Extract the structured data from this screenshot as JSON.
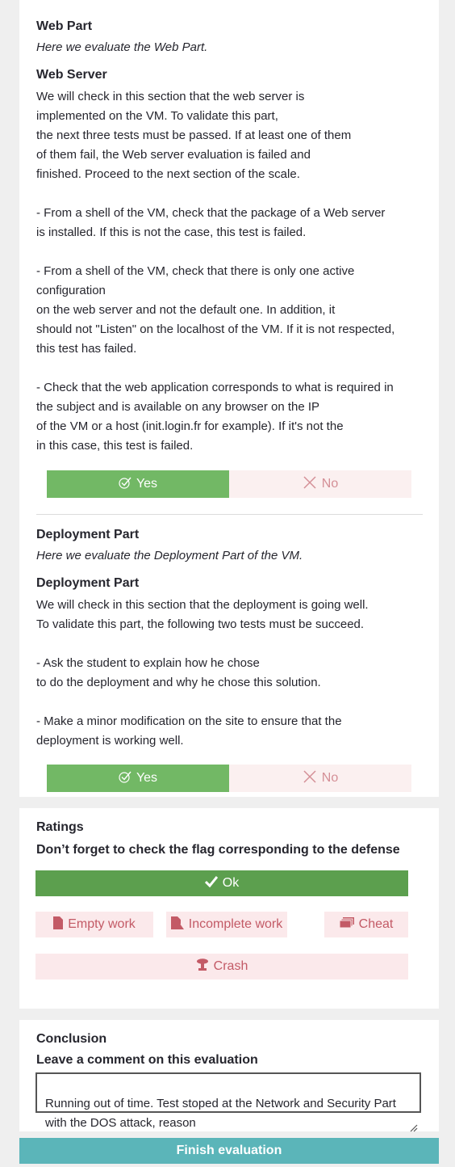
{
  "web_part": {
    "title": "Web Part",
    "subtitle": "Here we evaluate the Web Part.",
    "section_title": "Web Server",
    "description": "We will check in this section that the web server is\nimplemented on the VM. To validate this part,\nthe next three tests must be passed. If at least one of them\nof them fail, the Web server evaluation is failed and\nfinished. Proceed to the next section of the scale.\n\n- From a shell of the VM, check that the package of a Web server\nis installed. If this is not the case, this test is failed.\n\n- From a shell of the VM, check that there is only one active\nconfiguration\non the web server and not the default one. In addition, it\nshould not \"Listen\" on the localhost of the VM. If it is not respected,\nthis test has failed.\n\n- Check that the web application corresponds to what is required in\nthe subject and is available on any browser on the IP\nof the VM or a host (init.login.fr for example). If it's not the\nin this case, this test is failed.",
    "yes_label": "Yes",
    "no_label": "No"
  },
  "deployment_part": {
    "title": "Deployment Part",
    "subtitle": "Here we evaluate the Deployment Part of the VM.",
    "section_title": "Deployment Part",
    "description": "We will check in this section that the deployment is going well.\nTo validate this part, the following two tests must be succeed.\n\n- Ask the student to explain how he chose\nto do the deployment and why he chose this solution.\n\n- Make a minor modification on the site to ensure that the\ndeployment is working well.",
    "yes_label": "Yes",
    "no_label": "No"
  },
  "ratings": {
    "title": "Ratings",
    "instruction": "Don’t forget to check the flag corresponding to the defense",
    "ok_label": "Ok",
    "empty_work_label": "Empty work",
    "incomplete_work_label": "Incomplete work",
    "cheat_label": "Cheat",
    "crash_label": "Crash"
  },
  "conclusion": {
    "title": "Conclusion",
    "instruction": "Leave a comment on this evaluation",
    "comment": "Running out of time. Test stoped at the Network and Security Part\nwith the DOS attack, reason"
  },
  "finish_label": "Finish evaluation",
  "colors": {
    "yes_green": "#72b865",
    "ok_green": "#5c9f4e",
    "flag_red": "#c35a66",
    "finish_teal": "#5bb5b9"
  }
}
